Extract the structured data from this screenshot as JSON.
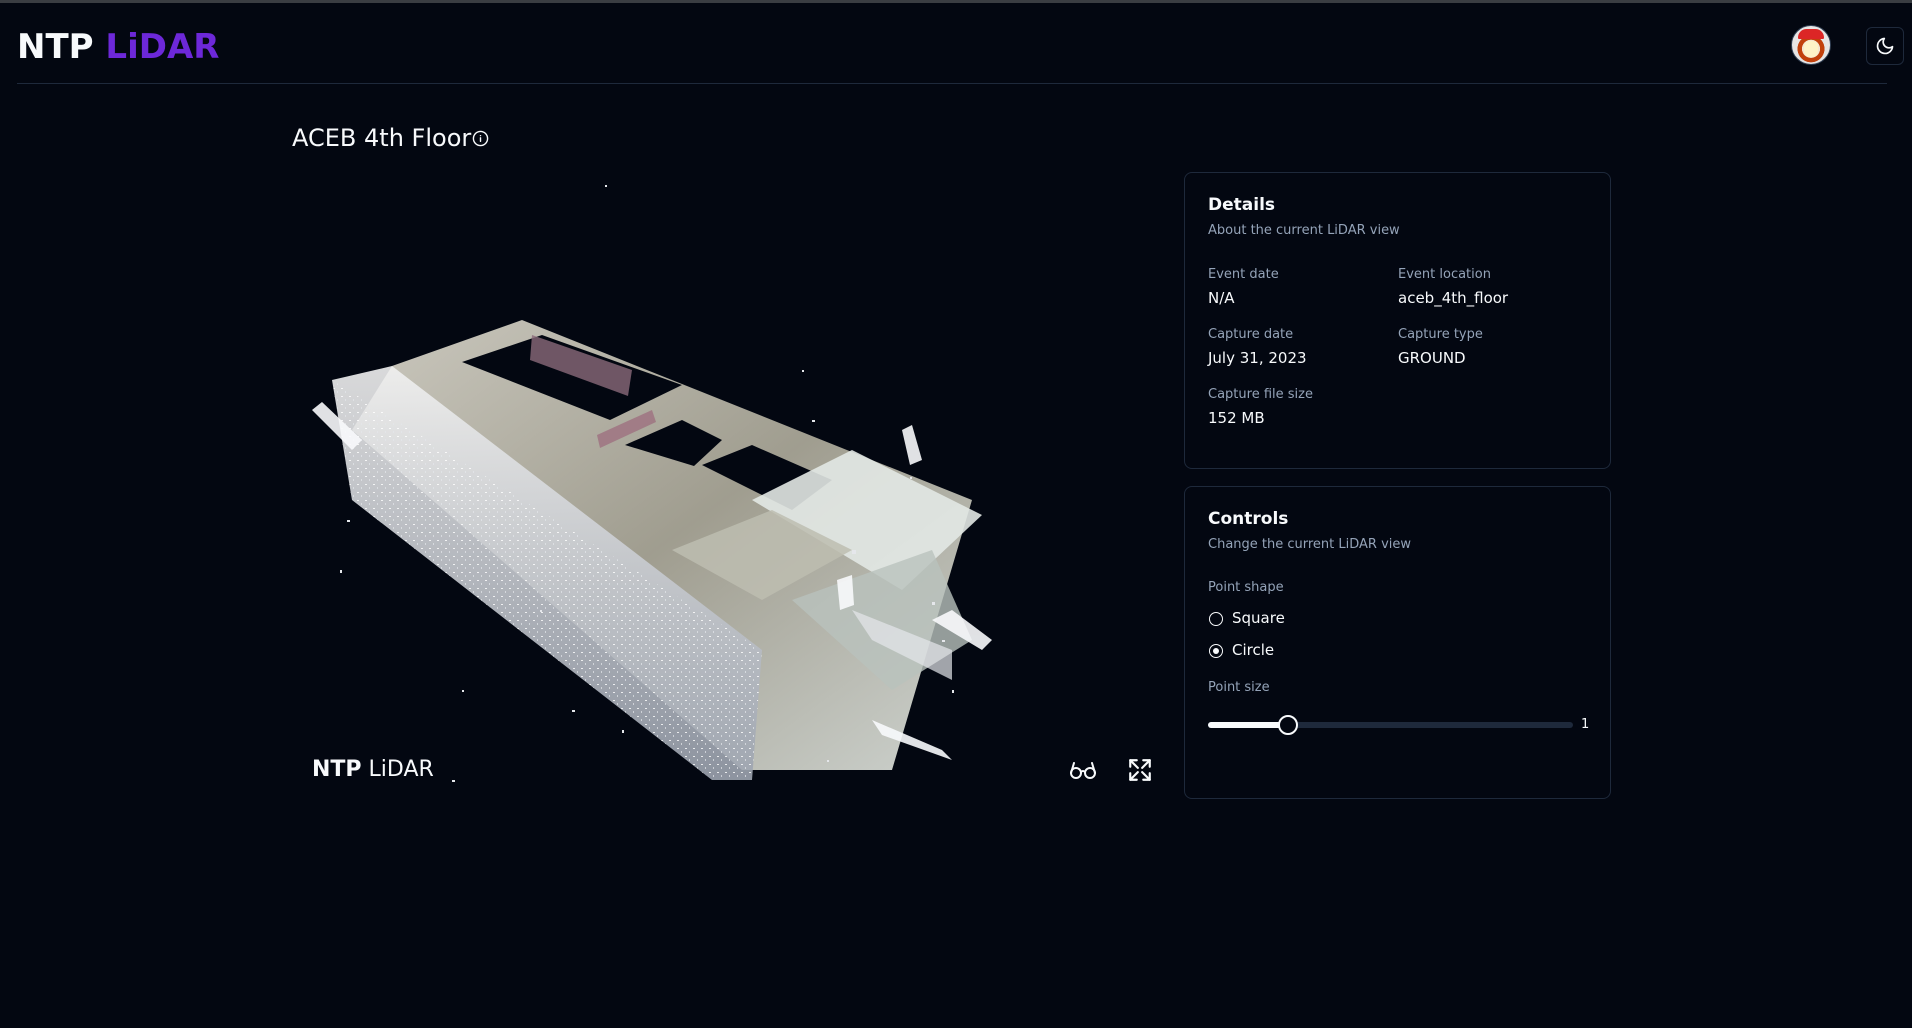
{
  "app": {
    "brand_part1": "NTP",
    "brand_part2": "LiDAR"
  },
  "header": {
    "avatar_icon": "user-avatar",
    "theme_toggle_icon": "moon-icon"
  },
  "main": {
    "page_title": "ACEB 4th Floor",
    "info_icon": "info-circle-icon",
    "viewer": {
      "brand_part1": "NTP",
      "brand_part2": "LiDAR",
      "glasses_icon": "glasses-icon",
      "fullscreen_icon": "expand-icon"
    }
  },
  "details": {
    "title": "Details",
    "subtitle": "About the current LiDAR view",
    "fields": [
      {
        "label": "Event date",
        "value": "N/A"
      },
      {
        "label": "Event location",
        "value": "aceb_4th_floor"
      },
      {
        "label": "Capture date",
        "value": "July 31, 2023"
      },
      {
        "label": "Capture type",
        "value": "GROUND"
      },
      {
        "label": "Capture file size",
        "value": "152 MB"
      }
    ]
  },
  "controls": {
    "title": "Controls",
    "subtitle": "Change the current LiDAR view",
    "point_shape_label": "Point shape",
    "point_shape_options": [
      {
        "label": "Square",
        "selected": false
      },
      {
        "label": "Circle",
        "selected": true
      }
    ],
    "point_size_label": "Point size",
    "point_size_value": "1",
    "point_size_fraction": 0.22
  },
  "colors": {
    "background": "#030711",
    "accent": "#6d28d9",
    "text": "#f8fafc",
    "muted": "#94a3b8",
    "border": "#1e293b"
  }
}
